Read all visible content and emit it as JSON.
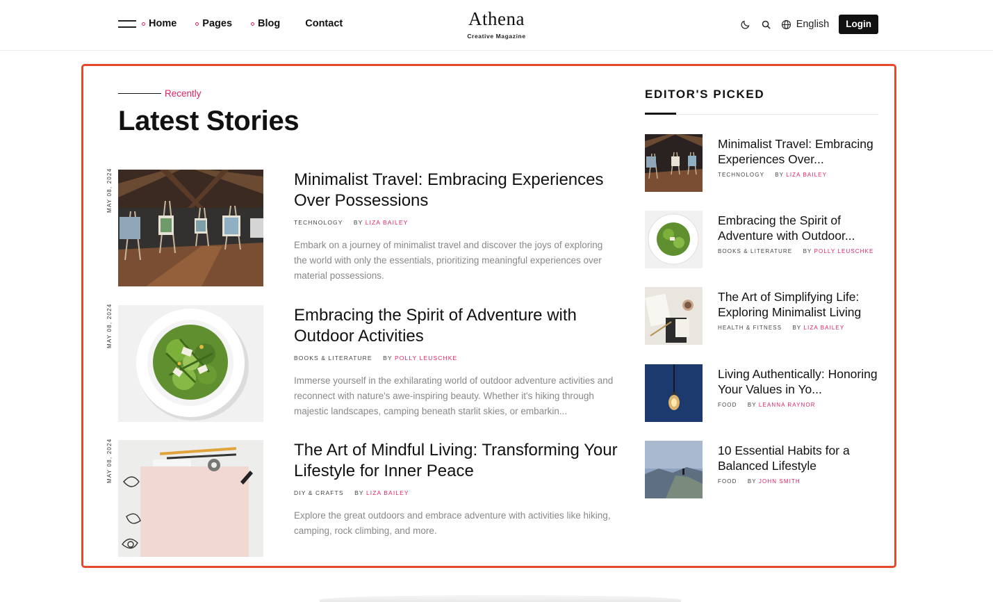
{
  "header": {
    "nav": [
      {
        "label": "Home",
        "dot": true
      },
      {
        "label": "Pages",
        "dot": true
      },
      {
        "label": "Blog",
        "dot": true
      },
      {
        "label": "Contact",
        "dot": false
      }
    ],
    "brand": {
      "name": "Athena",
      "tagline": "Creative Magazine"
    },
    "language": "English",
    "login_label": "Login"
  },
  "latest": {
    "eyebrow": "Recently",
    "title": "Latest Stories",
    "stories": [
      {
        "date": "MAY 08, 2024",
        "title": "Minimalist Travel: Embracing Experiences Over Possessions",
        "category": "TECHNOLOGY",
        "by": "BY",
        "author": "LIZA BAILEY",
        "excerpt": "Embark on a journey of minimalist travel and discover the joys of exploring the world with only the essentials, prioritizing meaningful experiences over material possessions."
      },
      {
        "date": "MAY 08, 2024",
        "title": "Embracing the Spirit of Adventure with Outdoor Activities",
        "category": "BOOKS & LITERATURE",
        "by": "BY",
        "author": "POLLY LEUSCHKE",
        "excerpt": "Immerse yourself in the exhilarating world of outdoor adventure activities and reconnect with nature's awe-inspiring beauty. Whether it's hiking through majestic landscapes, camping beneath starlit skies, or embarkin..."
      },
      {
        "date": "MAY 08, 2024",
        "title": "The Art of Mindful Living: Transforming Your Lifestyle for Inner Peace",
        "category": "DIY & CRAFTS",
        "by": "BY",
        "author": "LIZA BAILEY",
        "excerpt": "Explore the great outdoors and embrace adventure with activities like hiking, camping, rock climbing, and more."
      }
    ]
  },
  "editors": {
    "title": "EDITOR'S PICKED",
    "items": [
      {
        "title": "Minimalist Travel: Embracing Experiences Over...",
        "category": "TECHNOLOGY",
        "by": "BY",
        "author": "LIZA BAILEY"
      },
      {
        "title": "Embracing the Spirit of Adventure with Outdoor...",
        "category": "BOOKS & LITERATURE",
        "by": "BY",
        "author": "POLLY LEUSCHKE"
      },
      {
        "title": "The Art of Simplifying Life: Exploring Minimalist Living",
        "category": "HEALTH & FITNESS",
        "by": "BY",
        "author": "LIZA BAILEY"
      },
      {
        "title": "Living Authentically: Honoring Your Values in Yo...",
        "category": "FOOD",
        "by": "BY",
        "author": "LEANNA RAYNOR"
      },
      {
        "title": "10 Essential Habits for a Balanced Lifestyle",
        "category": "FOOD",
        "by": "BY",
        "author": "JOHN SMITH"
      }
    ]
  },
  "colors": {
    "accent": "#e0245e",
    "highlight_frame": "#e8472b",
    "text": "#111111",
    "muted": "#888888"
  }
}
